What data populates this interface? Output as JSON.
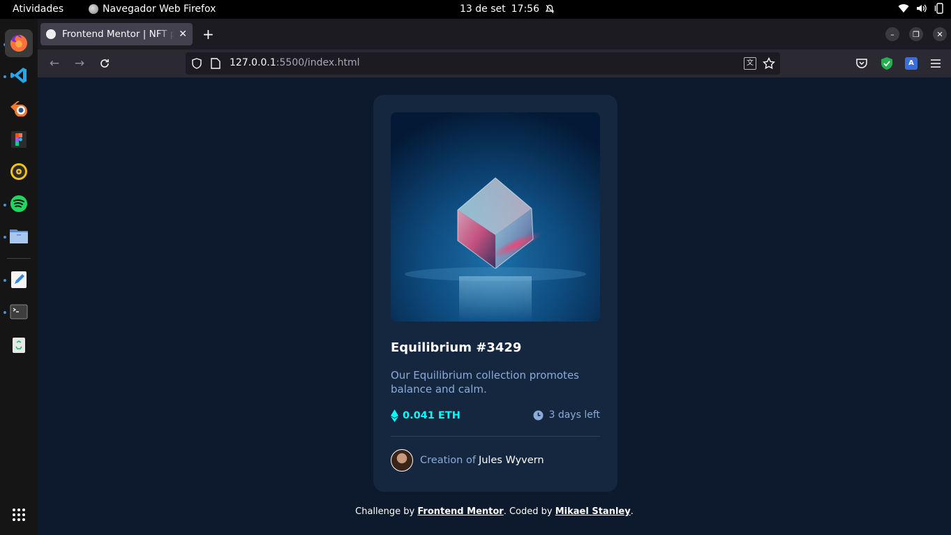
{
  "topbar": {
    "activities": "Atividades",
    "app_name": "Navegador Web Firefox",
    "date": "13 de set",
    "time": "17:56"
  },
  "dock": {
    "items": [
      "firefox-icon",
      "vscode-icon",
      "blender-icon",
      "figma-icon",
      "rhythmbox-icon",
      "spotify-icon",
      "files-icon",
      "text-editor-icon",
      "terminal-icon",
      "trash-icon",
      "app-grid-icon"
    ]
  },
  "browser": {
    "tab_title": "Frontend Mentor | NFT preview card component",
    "url_host": "127.0.0.1",
    "url_path": ":5500/index.html"
  },
  "card": {
    "title": "Equilibrium #3429",
    "description": "Our Equilibrium collection promotes balance and calm.",
    "price": "0.041 ETH",
    "time_left": "3 days left",
    "creation_prefix": "Creation of",
    "creator_name": "Jules Wyvern"
  },
  "attribution": {
    "prefix": "Challenge by",
    "fm_link": "Frontend Mentor",
    "middle": ". Coded by",
    "author_link": "Mikael Stanley",
    "suffix": "."
  },
  "colors": {
    "page_bg": "#0d192c",
    "card_bg": "#15263f",
    "cyan": "#00fff8",
    "soft_blue": "#8bacd9"
  }
}
